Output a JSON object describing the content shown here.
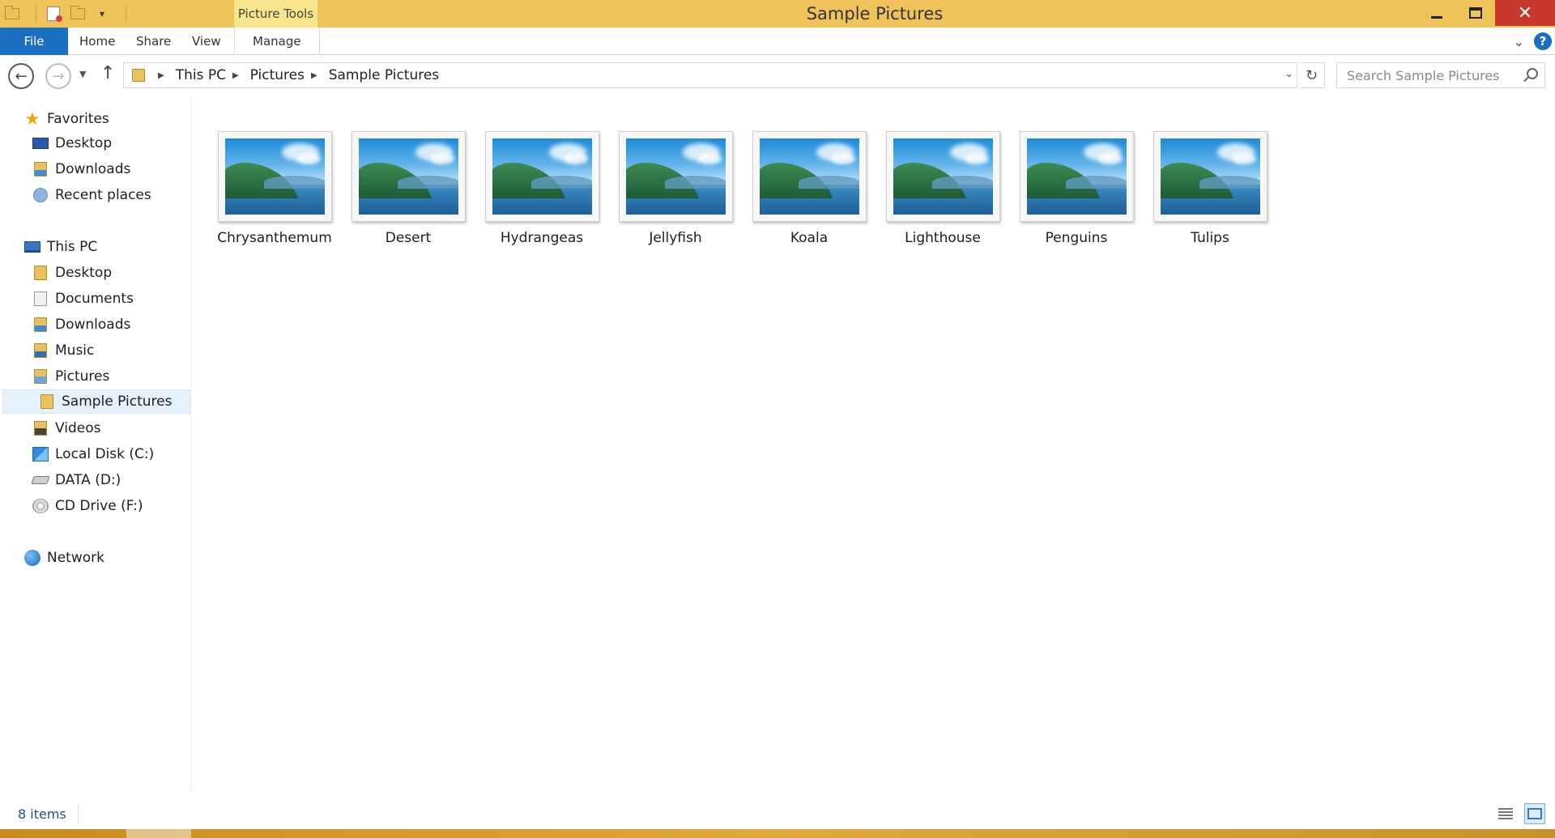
{
  "window": {
    "title": "Sample Pictures",
    "context_tab": "Picture Tools",
    "accent_title": "#efc25a",
    "accent_file": "#1a6fc0",
    "close_glyph": "✕"
  },
  "ribbon": {
    "file": "File",
    "tabs": [
      "Home",
      "Share",
      "View",
      "Manage"
    ]
  },
  "address": {
    "crumbs": [
      "This PC",
      "Pictures",
      "Sample Pictures"
    ],
    "search_placeholder": "Search Sample Pictures"
  },
  "nav": {
    "favorites": "Favorites",
    "favorites_items": [
      "Desktop",
      "Downloads",
      "Recent places"
    ],
    "this_pc": "This PC",
    "pc_items": [
      "Desktop",
      "Documents",
      "Downloads",
      "Music",
      "Pictures",
      "Sample Pictures",
      "Videos",
      "Local Disk (C:)",
      "DATA (D:)",
      "CD Drive (F:)"
    ],
    "network": "Network",
    "selected": "Sample Pictures"
  },
  "files": [
    "Chrysanthemum",
    "Desert",
    "Hydrangeas",
    "Jellyfish",
    "Koala",
    "Lighthouse",
    "Penguins",
    "Tulips"
  ],
  "status": {
    "count": "8 items"
  },
  "icons": {
    "back": "arrow-left-icon",
    "forward": "arrow-right-icon",
    "up": "arrow-up-icon",
    "refresh": "refresh-icon",
    "search": "search-icon",
    "help": "help-icon"
  }
}
